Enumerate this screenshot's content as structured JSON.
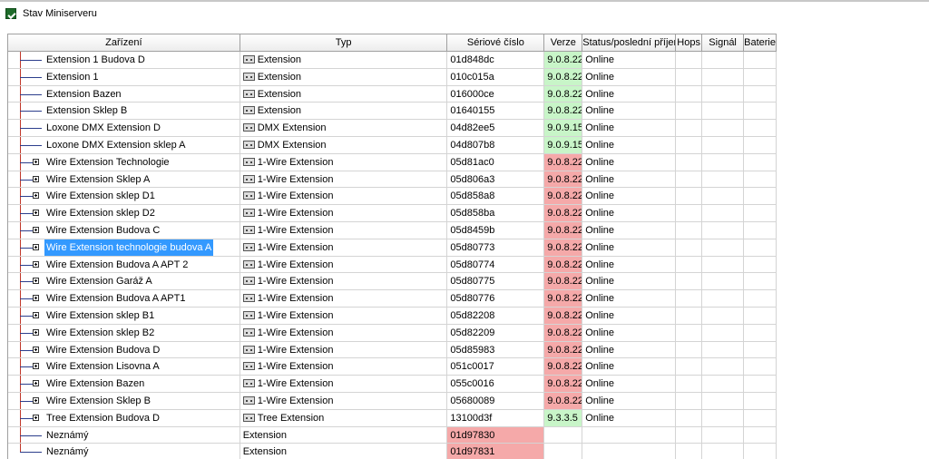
{
  "window": {
    "title": "Stav Miniserveru"
  },
  "table": {
    "headers": [
      "Zařízení",
      "Typ",
      "Sériové číslo",
      "Verze",
      "Status/poslední příjem",
      "Hops",
      "Signál",
      "Baterie"
    ],
    "rows": [
      {
        "name": "Extension 1 Budova D",
        "type": "Extension",
        "type_icon": "extension-icon",
        "serial": "01d848dc",
        "version": "9.0.8.22",
        "version_status": "ok",
        "status": "Online"
      },
      {
        "name": "Extension 1",
        "type": "Extension",
        "type_icon": "extension-icon",
        "serial": "010c015a",
        "version": "9.0.8.22",
        "version_status": "ok",
        "status": "Online"
      },
      {
        "name": "Extension Bazen",
        "type": "Extension",
        "type_icon": "extension-icon",
        "serial": "016000ce",
        "version": "9.0.8.22",
        "version_status": "ok",
        "status": "Online"
      },
      {
        "name": "Extension Sklep B",
        "type": "Extension",
        "type_icon": "extension-icon",
        "serial": "01640155",
        "version": "9.0.8.22",
        "version_status": "ok",
        "status": "Online"
      },
      {
        "name": "Loxone DMX Extension D",
        "type": "DMX Extension",
        "type_icon": "dmx-extension-icon",
        "serial": "04d82ee5",
        "version": "9.0.9.15",
        "version_status": "ok",
        "status": "Online"
      },
      {
        "name": "Loxone DMX Extension sklep A",
        "type": "DMX Extension",
        "type_icon": "dmx-extension-icon",
        "serial": "04d807b8",
        "version": "9.0.9.15",
        "version_status": "ok",
        "status": "Online"
      },
      {
        "name": "Wire Extension Technologie",
        "type": "1-Wire Extension",
        "type_icon": "wire-extension-icon",
        "expandable": true,
        "serial": "05d81ac0",
        "version": "9.0.8.22",
        "version_status": "bad",
        "status": "Online"
      },
      {
        "name": "Wire Extension Sklep A",
        "type": "1-Wire Extension",
        "type_icon": "wire-extension-icon",
        "expandable": true,
        "serial": "05d806a3",
        "version": "9.0.8.22",
        "version_status": "bad",
        "status": "Online"
      },
      {
        "name": "Wire Extension sklep D1",
        "type": "1-Wire Extension",
        "type_icon": "wire-extension-icon",
        "expandable": true,
        "serial": "05d858a8",
        "version": "9.0.8.22",
        "version_status": "bad",
        "status": "Online"
      },
      {
        "name": "Wire Extension sklep D2",
        "type": "1-Wire Extension",
        "type_icon": "wire-extension-icon",
        "expandable": true,
        "serial": "05d858ba",
        "version": "9.0.8.22",
        "version_status": "bad",
        "status": "Online"
      },
      {
        "name": "Wire Extension Budova C",
        "type": "1-Wire Extension",
        "type_icon": "wire-extension-icon",
        "expandable": true,
        "serial": "05d8459b",
        "version": "9.0.8.22",
        "version_status": "bad",
        "status": "Online"
      },
      {
        "name": "Wire Extension technologie budova A",
        "type": "1-Wire Extension",
        "type_icon": "wire-extension-icon",
        "expandable": true,
        "selected": true,
        "serial": "05d80773",
        "version": "9.0.8.22",
        "version_status": "bad",
        "status": "Online"
      },
      {
        "name": "Wire Extension Budova A APT 2",
        "type": "1-Wire Extension",
        "type_icon": "wire-extension-icon",
        "expandable": true,
        "serial": "05d80774",
        "version": "9.0.8.22",
        "version_status": "bad",
        "status": "Online"
      },
      {
        "name": "Wire Extension Garáž A",
        "type": "1-Wire Extension",
        "type_icon": "wire-extension-icon",
        "expandable": true,
        "serial": "05d80775",
        "version": "9.0.8.22",
        "version_status": "bad",
        "status": "Online"
      },
      {
        "name": "Wire Extension Budova A APT1",
        "type": "1-Wire Extension",
        "type_icon": "wire-extension-icon",
        "expandable": true,
        "serial": "05d80776",
        "version": "9.0.8.22",
        "version_status": "bad",
        "status": "Online"
      },
      {
        "name": "Wire Extension sklep B1",
        "type": "1-Wire Extension",
        "type_icon": "wire-extension-icon",
        "expandable": true,
        "serial": "05d82208",
        "version": "9.0.8.22",
        "version_status": "bad",
        "status": "Online"
      },
      {
        "name": "Wire Extension sklep B2",
        "type": "1-Wire Extension",
        "type_icon": "wire-extension-icon",
        "expandable": true,
        "serial": "05d82209",
        "version": "9.0.8.22",
        "version_status": "bad",
        "status": "Online"
      },
      {
        "name": "Wire Extension Budova D",
        "type": "1-Wire Extension",
        "type_icon": "wire-extension-icon",
        "expandable": true,
        "serial": "05d85983",
        "version": "9.0.8.22",
        "version_status": "bad",
        "status": "Online"
      },
      {
        "name": "Wire Extension Lisovna A",
        "type": "1-Wire Extension",
        "type_icon": "wire-extension-icon",
        "expandable": true,
        "serial": "051c0017",
        "version": "9.0.8.22",
        "version_status": "bad",
        "status": "Online"
      },
      {
        "name": "Wire Extension Bazen",
        "type": "1-Wire Extension",
        "type_icon": "wire-extension-icon",
        "expandable": true,
        "serial": "055c0016",
        "version": "9.0.8.22",
        "version_status": "bad",
        "status": "Online"
      },
      {
        "name": "Wire Extension Sklep B",
        "type": "1-Wire Extension",
        "type_icon": "wire-extension-icon",
        "expandable": true,
        "serial": "05680089",
        "version": "9.0.8.22",
        "version_status": "bad",
        "status": "Online"
      },
      {
        "name": "Tree Extension Budova D",
        "type": "Tree Extension",
        "type_icon": "tree-extension-icon",
        "expandable": true,
        "serial": "13100d3f",
        "version": "9.3.3.5",
        "version_status": "ok",
        "status": "Online"
      },
      {
        "name": "Neznámý",
        "type": "Extension",
        "serial": "01d97830",
        "serial_status": "bad",
        "version": "",
        "status": ""
      },
      {
        "name": "Neznámý",
        "type": "Extension",
        "serial": "01d97831",
        "serial_status": "bad",
        "version": "",
        "status": ""
      }
    ]
  },
  "colors": {
    "version_ok": "#c8f5c8",
    "version_bad": "#f5a9a9",
    "selection": "#3399ff"
  }
}
